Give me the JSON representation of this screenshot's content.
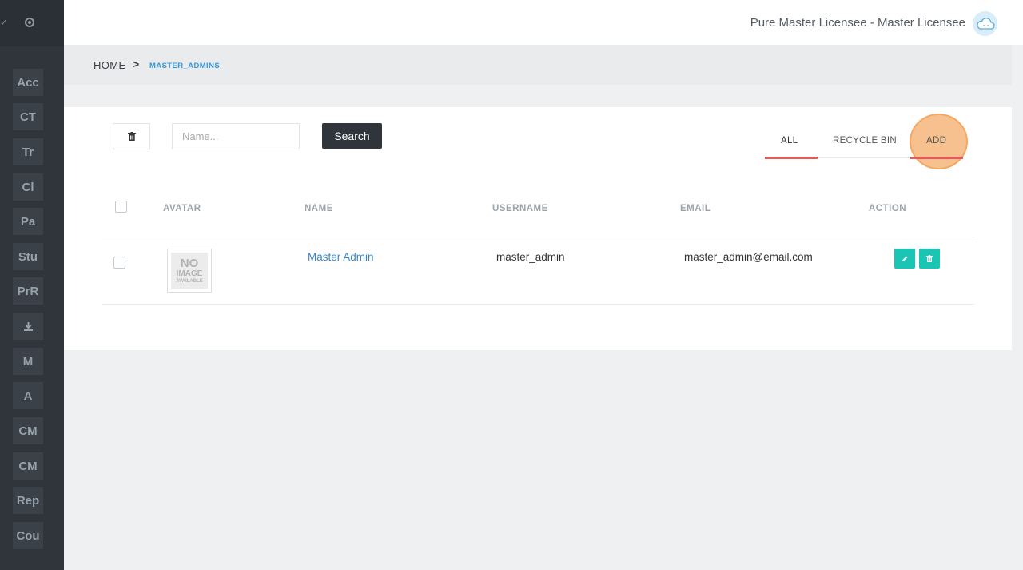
{
  "sidebar": {
    "items": [
      {
        "label": "Acc"
      },
      {
        "label": "CT"
      },
      {
        "label": "Tr"
      },
      {
        "label": "Cl"
      },
      {
        "label": "Pa"
      },
      {
        "label": "Stu"
      },
      {
        "label": "PrR"
      },
      {
        "icon": "download-icon"
      },
      {
        "label": "M"
      },
      {
        "label": "A"
      },
      {
        "label": "CM"
      },
      {
        "label": "CM"
      },
      {
        "label": "Rep"
      },
      {
        "label": "Cou"
      }
    ]
  },
  "header": {
    "user_name": "Pure Master Licensee - Master Licensee",
    "avatar_icon": "cloud-icon"
  },
  "breadcrumb": {
    "home": "HOME",
    "separator": ">",
    "current": "MASTER_ADMINS"
  },
  "toolbar": {
    "search_placeholder": "Name...",
    "search_label": "Search"
  },
  "tabs": {
    "all": "ALL",
    "recycle": "RECYCLE BIN",
    "add": "ADD"
  },
  "table": {
    "headers": {
      "avatar": "AVATAR",
      "name": "NAME",
      "username": "USERNAME",
      "email": "EMAIL",
      "action": "ACTION"
    },
    "rows": [
      {
        "avatar_text": [
          "NO",
          "IMAGE",
          "AVAILABLE"
        ],
        "name": "Master Admin",
        "username": "master_admin",
        "email": "master_admin@email.com"
      }
    ]
  },
  "colors": {
    "accent": "#3598dc",
    "action": "#1bc5b4",
    "tab_underline": "#e35b5a",
    "highlight": "#f7be8a"
  }
}
